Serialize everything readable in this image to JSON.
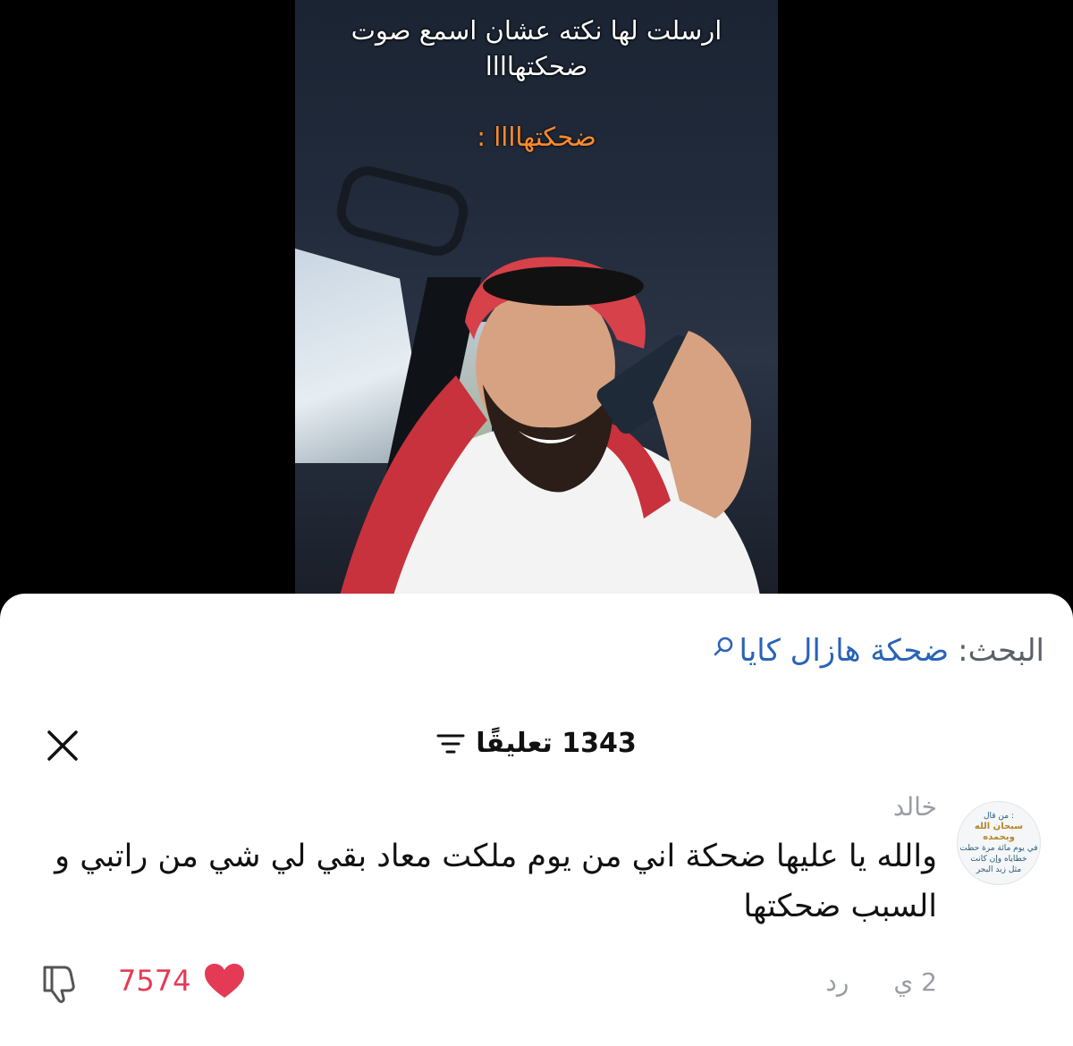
{
  "video": {
    "caption_line1": "ارسلت لها نكته عشان اسمع صوت",
    "caption_line2": "ضحكتهاااا",
    "caption_reaction": "ضحكتهاااا :"
  },
  "search": {
    "label": "البحث:",
    "query": "ضحكة هازال كايا"
  },
  "comments": {
    "count_label": "1343 تعليقًا",
    "items": [
      {
        "username": "خالد",
        "text": "والله يا عليها ضحكة اني من يوم ملكت معاد بقي لي شي من راتبي و السبب ضحكتها",
        "time": "2 ي",
        "reply_label": "رد",
        "likes": "7574",
        "avatar_lines": [
          "من قال :",
          "سبحان الله وبحمده",
          "في يوم مائة مرة حطت",
          "خطاياه وإن كانت",
          "مثل زبد البحر"
        ]
      }
    ]
  },
  "colors": {
    "accent_link": "#2a63b8",
    "like_red": "#e53a55",
    "caption_orange": "#ff8a2a"
  }
}
